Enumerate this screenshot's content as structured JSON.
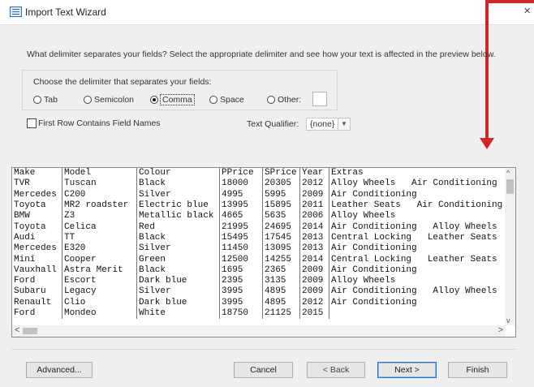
{
  "window": {
    "title": "Import Text Wizard",
    "close_glyph": "×",
    "icon": "table-icon"
  },
  "instructions": "What delimiter separates your fields? Select the appropriate delimiter and see how your text is affected in the preview below.",
  "delimiter": {
    "group_label": "Choose the delimiter that separates your fields:",
    "options": [
      {
        "label": "Tab",
        "selected": false
      },
      {
        "label": "Semicolon",
        "selected": false
      },
      {
        "label": "Comma",
        "selected": true
      },
      {
        "label": "Space",
        "selected": false
      },
      {
        "label": "Other:",
        "selected": false
      }
    ],
    "other_value": ""
  },
  "first_row_checkbox": {
    "label": "First Row Contains Field Names",
    "checked": false
  },
  "text_qualifier": {
    "label": "Text Qualifier:",
    "value": "{none}"
  },
  "preview": {
    "rows": [
      [
        "Make",
        "Model",
        "Colour",
        "PPrice",
        "SPrice",
        "Year",
        "Extras"
      ],
      [
        "TVR",
        "Tuscan",
        "Black",
        "18000",
        "20305",
        "2012",
        "Alloy Wheels   Air Conditioning"
      ],
      [
        "Mercedes",
        "C200",
        "Silver",
        "4995",
        "5995",
        "2009",
        "Air Conditioning"
      ],
      [
        "Toyota",
        "MR2 roadster",
        "Electric blue",
        "13995",
        "15895",
        "2011",
        "Leather Seats   Air Conditioning"
      ],
      [
        "BMW",
        "Z3",
        "Metallic black",
        "4665",
        "5635",
        "2006",
        "Alloy Wheels"
      ],
      [
        "Toyota",
        "Celica",
        "Red",
        "21995",
        "24695",
        "2014",
        "Air Conditioning   Alloy Wheels"
      ],
      [
        "Audi",
        "TT",
        "Black",
        "15495",
        "17545",
        "2013",
        "Central Locking   Leather Seats"
      ],
      [
        "Mercedes",
        "E320",
        "Silver",
        "11450",
        "13095",
        "2013",
        "Air Conditioning"
      ],
      [
        "Mini",
        "Cooper",
        "Green",
        "12500",
        "14255",
        "2014",
        "Central Locking   Leather Seats"
      ],
      [
        "Vauxhall",
        "Astra Merit",
        "Black",
        "1695",
        "2365",
        "2009",
        "Air Conditioning"
      ],
      [
        "Ford",
        "Escort",
        "Dark blue",
        "2395",
        "3135",
        "2009",
        "Alloy Wheels"
      ],
      [
        "Subaru",
        "Legacy",
        "Silver",
        "3995",
        "4895",
        "2009",
        "Air Conditioning   Alloy Wheels"
      ],
      [
        "Renault",
        "Clio",
        "Dark blue",
        "3995",
        "4895",
        "2012",
        "Air Conditioning"
      ],
      [
        "Ford",
        "Mondeo",
        "White",
        "18750",
        "21125",
        "2015",
        ""
      ]
    ],
    "scroll_glyphs": {
      "up": "^",
      "down": "v",
      "left": "<",
      "right": ">"
    }
  },
  "buttons": {
    "advanced": "Advanced...",
    "cancel": "Cancel",
    "back": "< Back",
    "next": "Next >",
    "finish": "Finish"
  },
  "colors": {
    "annotation_arrow": "#d0262a",
    "default_button_border": "#2a71c4"
  }
}
